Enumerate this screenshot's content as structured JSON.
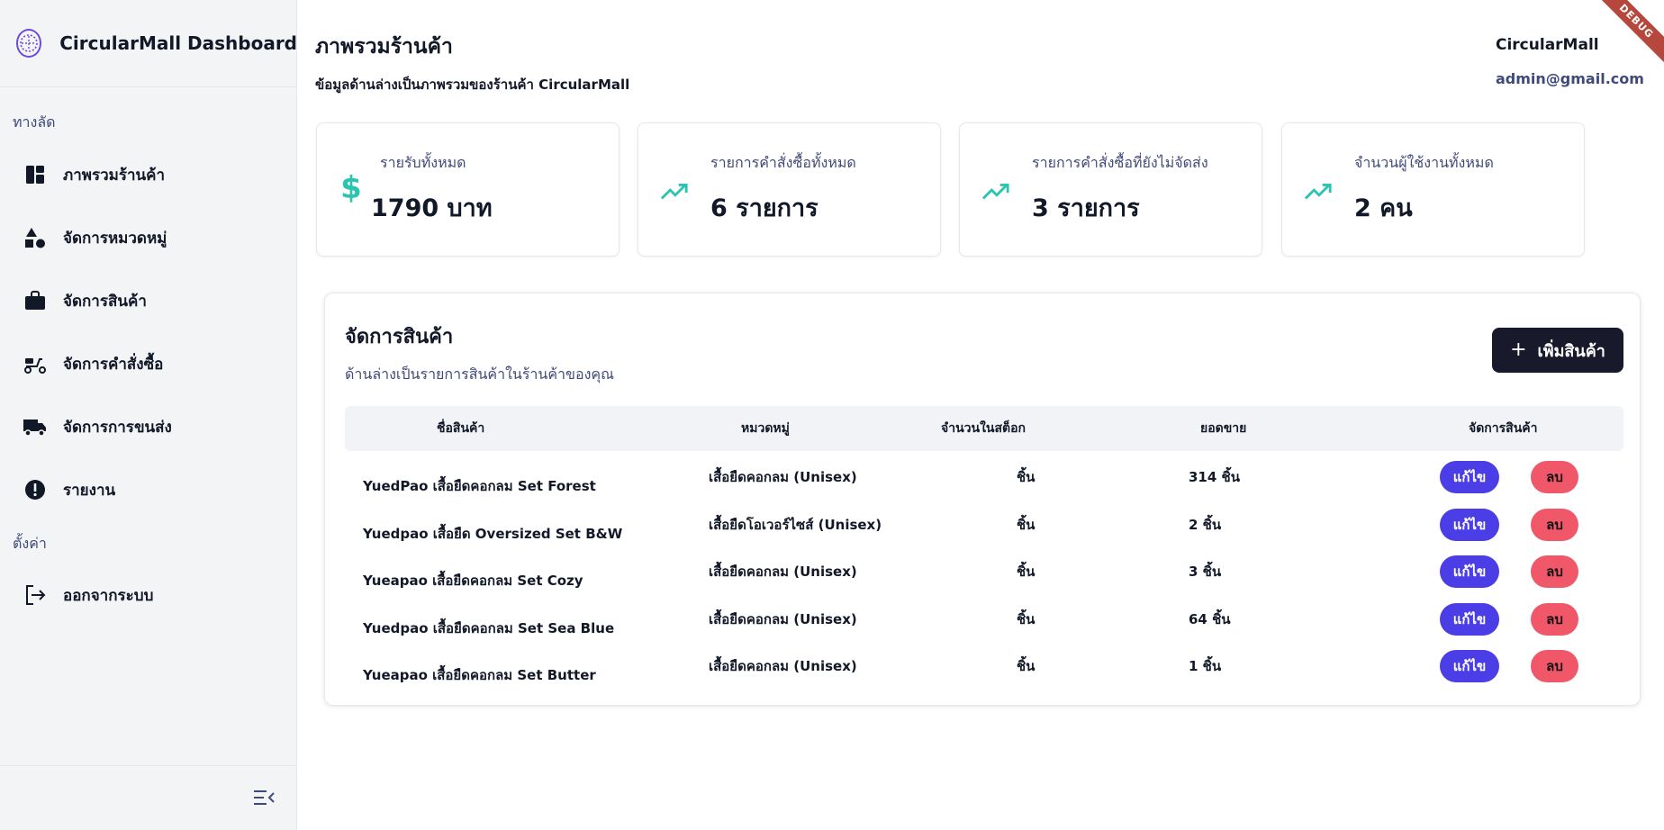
{
  "brand": {
    "title": "CircularMall Dashboard"
  },
  "sidebar": {
    "shortcut_label": "ทางลัด",
    "settings_label": "ตั้งค่า",
    "items": [
      {
        "label": "ภาพรวมร้านค้า",
        "icon": "dashboard-icon"
      },
      {
        "label": "จัดการหมวดหมู่",
        "icon": "category-shapes-icon"
      },
      {
        "label": "จัดการสินค้า",
        "icon": "briefcase-icon"
      },
      {
        "label": "จัดการคำสั่งซื้อ",
        "icon": "scooter-icon"
      },
      {
        "label": "จัดการการขนส่ง",
        "icon": "truck-icon"
      },
      {
        "label": "รายงาน",
        "icon": "alert-icon"
      }
    ],
    "logout": {
      "label": "ออกจากระบบ",
      "icon": "logout-icon"
    }
  },
  "header": {
    "title": "ภาพรวมร้านค้า",
    "subtitle": "ข้อมูลด้านล่างเป็นภาพรวมของร้านค้า CircularMall",
    "user_name": "CircularMall",
    "user_email": "admin@gmail.com",
    "debug_banner": "DEBUG"
  },
  "stats": [
    {
      "label": "รายรับทั้งหมด",
      "value": "1790 บาท",
      "icon": "dollar-icon"
    },
    {
      "label": "รายการคำสั่งซื้อทั้งหมด",
      "value": "6 รายการ",
      "icon": "trending-up-icon"
    },
    {
      "label": "รายการคำสั่งซื้อที่ยังไม่จัดส่ง",
      "value": "3 รายการ",
      "icon": "trending-up-icon"
    },
    {
      "label": "จำนวนผู้ใช้งานทั้งหมด",
      "value": "2 คน",
      "icon": "trending-up-icon"
    }
  ],
  "products": {
    "title": "จัดการสินค้า",
    "subtitle": "ด้านล่างเป็นรายการสินค้าในร้านค้าของคุณ",
    "add_button": "เพิ่มสินค้า",
    "columns": [
      "ชื่อสินค้า",
      "หมวดหมู่",
      "จำนวนในสต็อก",
      "ยอดขาย",
      "จัดการสินค้า"
    ],
    "edit_label": "แก้ไข",
    "delete_label": "ลบ",
    "rows": [
      {
        "name": "YuedPao เสื้อยืดคอกลม Set Forest",
        "category": "เสื้อยืดคอกลม (Unisex)",
        "stock": "ชิ้น",
        "sales": "314 ชิ้น"
      },
      {
        "name": "Yuedpao เสื้อยืด Oversized Set B&W",
        "category": "เสื้อยืดโอเวอร์ไซส์ (Unisex)",
        "stock": "ชิ้น",
        "sales": "2 ชิ้น"
      },
      {
        "name": "Yueapao เสื้อยืดคอกลม Set Cozy",
        "category": "เสื้อยืดคอกลม (Unisex)",
        "stock": "ชิ้น",
        "sales": "3 ชิ้น"
      },
      {
        "name": "Yuedpao เสื้อยืดคอกลม Set Sea Blue",
        "category": "เสื้อยืดคอกลม (Unisex)",
        "stock": "ชิ้น",
        "sales": "64 ชิ้น"
      },
      {
        "name": "Yueapao เสื้อยืดคอกลม Set Butter",
        "category": "เสื้อยืดคอกลม (Unisex)",
        "stock": "ชิ้น",
        "sales": "1 ชิ้น"
      }
    ]
  },
  "colors": {
    "accent": "#4c3ee6",
    "danger": "#f0586a",
    "teal": "#2bc4b0",
    "dark_button": "#181a2b"
  }
}
